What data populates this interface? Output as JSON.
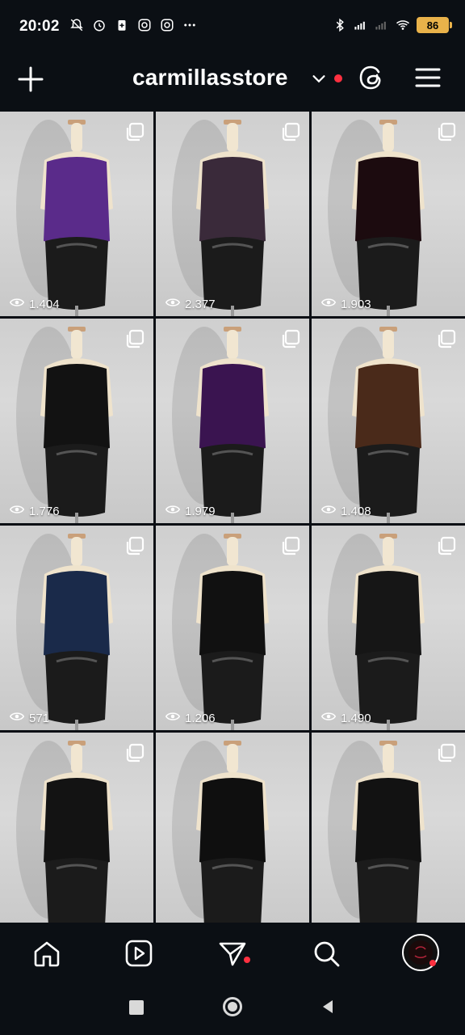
{
  "status_bar": {
    "time": "20:02",
    "left_icons": [
      "mute-bell-icon",
      "alarm-icon",
      "battery-saver-icon",
      "instagram-icon",
      "instagram-icon",
      "more-dots-icon"
    ],
    "right_icons": [
      "bluetooth-icon",
      "signal-icon",
      "signal-icon",
      "wifi-icon"
    ],
    "battery_level": "86"
  },
  "header": {
    "username": "carmillasstore",
    "has_notification_dot": true
  },
  "grid": {
    "posts": [
      {
        "views": "1.404",
        "top_color": "#5a2b8a",
        "bottom_color": "#1b1b1b",
        "multi": true
      },
      {
        "views": "2.377",
        "top_color": "#3a2a3a",
        "bottom_color": "#1b1b1b",
        "multi": true
      },
      {
        "views": "1.903",
        "top_color": "#1c0b0f",
        "bottom_color": "#1b1b1b",
        "multi": true
      },
      {
        "views": "1.776",
        "top_color": "#121212",
        "bottom_color": "#1b1b1b",
        "multi": true
      },
      {
        "views": "1.979",
        "top_color": "#3a1450",
        "bottom_color": "#1b1b1b",
        "multi": true
      },
      {
        "views": "1.408",
        "top_color": "#4a2a1a",
        "bottom_color": "#1b1b1b",
        "multi": true
      },
      {
        "views": "571",
        "top_color": "#1a2a4a",
        "bottom_color": "#1b1b1b",
        "multi": true
      },
      {
        "views": "1.206",
        "top_color": "#111111",
        "bottom_color": "#1b1b1b",
        "multi": true
      },
      {
        "views": "1.490",
        "top_color": "#161616",
        "bottom_color": "#1b1b1b",
        "multi": true
      },
      {
        "views": "",
        "top_color": "#131313",
        "bottom_color": "#1b1b1b",
        "multi": true
      },
      {
        "views": "",
        "top_color": "#0f0f0f",
        "bottom_color": "#1b1b1b",
        "multi": false
      },
      {
        "views": "",
        "top_color": "#121212",
        "bottom_color": "#1b1b1b",
        "multi": true
      }
    ]
  },
  "bottom_nav": {
    "items": [
      "home-icon",
      "reels-icon",
      "direct-icon",
      "search-icon",
      "profile-avatar"
    ]
  },
  "system_nav": [
    "recents-square-icon",
    "home-circle-icon",
    "back-triangle-icon"
  ],
  "colors": {
    "background": "#0b0f14",
    "accent_red": "#ff3040",
    "battery": "#e9b24a"
  }
}
